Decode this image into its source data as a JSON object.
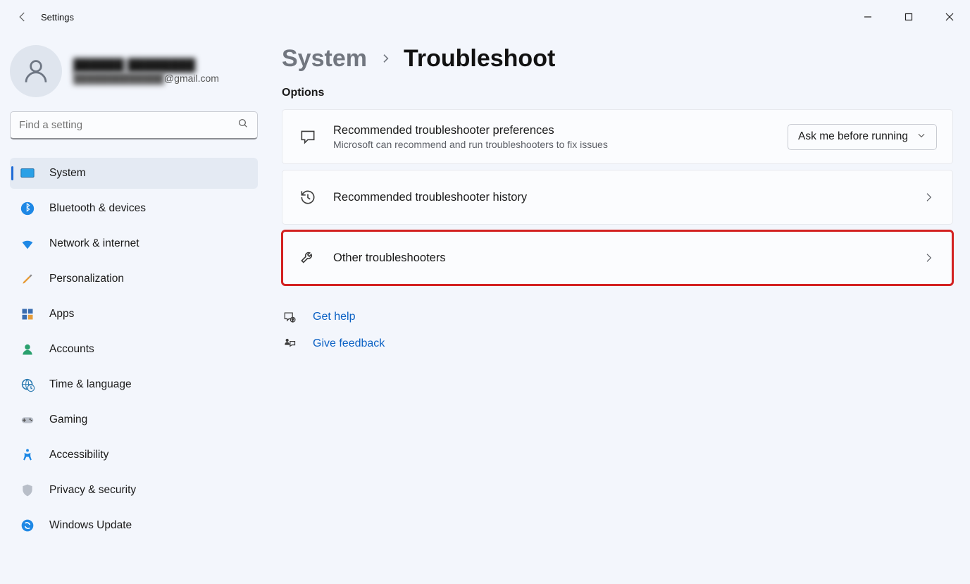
{
  "window": {
    "app_title": "Settings"
  },
  "profile": {
    "name": "██████ ████████",
    "email_prefix": "█████████████",
    "email_suffix": "@gmail.com"
  },
  "search": {
    "placeholder": "Find a setting"
  },
  "nav": {
    "items": [
      {
        "label": "System"
      },
      {
        "label": "Bluetooth & devices"
      },
      {
        "label": "Network & internet"
      },
      {
        "label": "Personalization"
      },
      {
        "label": "Apps"
      },
      {
        "label": "Accounts"
      },
      {
        "label": "Time & language"
      },
      {
        "label": "Gaming"
      },
      {
        "label": "Accessibility"
      },
      {
        "label": "Privacy & security"
      },
      {
        "label": "Windows Update"
      }
    ]
  },
  "breadcrumb": {
    "parent": "System",
    "current": "Troubleshoot"
  },
  "section_label": "Options",
  "cards": {
    "rec_pref": {
      "title": "Recommended troubleshooter preferences",
      "sub": "Microsoft can recommend and run troubleshooters to fix issues",
      "dropdown_value": "Ask me before running"
    },
    "rec_history": {
      "title": "Recommended troubleshooter history"
    },
    "other": {
      "title": "Other troubleshooters"
    }
  },
  "footer": {
    "get_help": "Get help",
    "give_feedback": "Give feedback"
  }
}
